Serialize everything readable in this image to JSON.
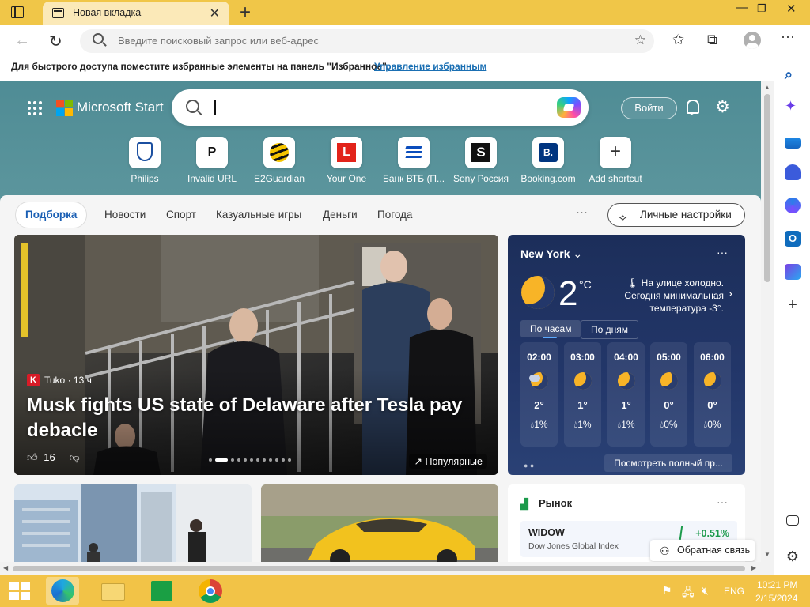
{
  "browser": {
    "tab_title": "Новая вкладка",
    "omnibox_placeholder": "Введите поисковый запрос или веб-адрес"
  },
  "favorites_bar": {
    "text": "Для быстрого доступа поместите избранные элементы на панель \"Избранное\".",
    "link": "Управление избранным"
  },
  "header": {
    "brand": "Microsoft Start",
    "login": "Войти"
  },
  "shortcuts": [
    {
      "label": "Philips",
      "glyph": "",
      "icon": "philips-icon"
    },
    {
      "label": "Invalid URL",
      "glyph": "P",
      "icon": "p-icon"
    },
    {
      "label": "E2Guardian",
      "glyph": "",
      "icon": "e2guardian-icon"
    },
    {
      "label": "Your One",
      "glyph": "L",
      "icon": "l-icon"
    },
    {
      "label": "Банк ВТБ (П...",
      "glyph": "",
      "icon": "vtb-icon"
    },
    {
      "label": "Sony Россия",
      "glyph": "S",
      "icon": "sony-icon"
    },
    {
      "label": "Booking.com",
      "glyph": "B.",
      "icon": "booking-icon"
    },
    {
      "label": "Add shortcut",
      "glyph": "+",
      "icon": "plus-icon"
    }
  ],
  "feed_tabs": [
    "Подборка",
    "Новости",
    "Спорт",
    "Казуальные игры",
    "Деньги",
    "Погода"
  ],
  "feed_more": "···",
  "personal_settings": "Личные настройки",
  "hero": {
    "source_logo": "K",
    "source": "Tuko · 13 ч",
    "title": "Musk fights US state of Delaware after Tesla pay debacle",
    "likes": "16",
    "popular": "Популярные"
  },
  "weather": {
    "location": "New York",
    "temp": "2",
    "unit": "°C",
    "description": "На улице холодно. Сегодня минимальная температура -3°.",
    "tab_hourly": "По часам",
    "tab_daily": "По дням",
    "hours": [
      {
        "time": "02:00",
        "temp": "2°",
        "precip": "1%",
        "icon": "cloudy-moon-icon"
      },
      {
        "time": "03:00",
        "temp": "1°",
        "precip": "1%",
        "icon": "moon-icon"
      },
      {
        "time": "04:00",
        "temp": "1°",
        "precip": "1%",
        "icon": "moon-icon"
      },
      {
        "time": "05:00",
        "temp": "0°",
        "precip": "0%",
        "icon": "moon-icon"
      },
      {
        "time": "06:00",
        "temp": "0°",
        "precip": "0%",
        "icon": "moon-icon"
      }
    ],
    "full_forecast": "Посмотреть полный пр..."
  },
  "market": {
    "title": "Рынок",
    "symbol": "WIDOW",
    "name": "Dow Jones Global Index",
    "change": "+0.51%"
  },
  "feedback": "Обратная связь",
  "taskbar": {
    "lang": "ENG",
    "time": "10:21 PM",
    "date": "2/15/2024"
  },
  "colors": {
    "titlebar": "#f0c648",
    "taskbar": "#f2c347",
    "accent": "#1a5fb4",
    "weather_bg": "#23376a"
  }
}
